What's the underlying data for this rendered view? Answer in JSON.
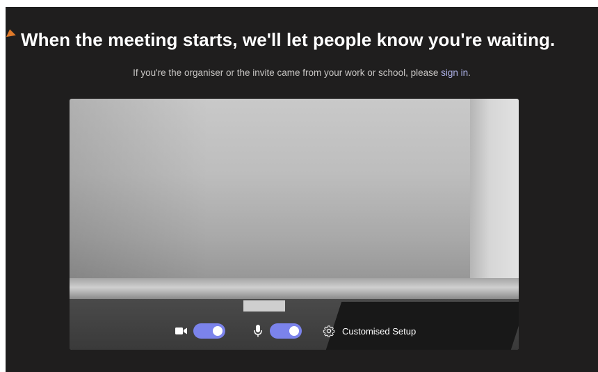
{
  "header": {
    "title": "When the meeting starts, we'll let people know you're waiting.",
    "subtitle_text": "If you're the organiser or the invite came from your work or school, please ",
    "subtitle_link": "sign in",
    "subtitle_end": "."
  },
  "preview": {
    "controls": {
      "camera_icon": "video-camera-icon",
      "camera_on": true,
      "mic_icon": "microphone-icon",
      "mic_on": true,
      "settings_icon": "gear-icon",
      "setup_label": "Customised Setup"
    }
  },
  "colors": {
    "background": "#1f1e1e",
    "accent": "#7b83eb",
    "link": "#aeb2e8"
  }
}
